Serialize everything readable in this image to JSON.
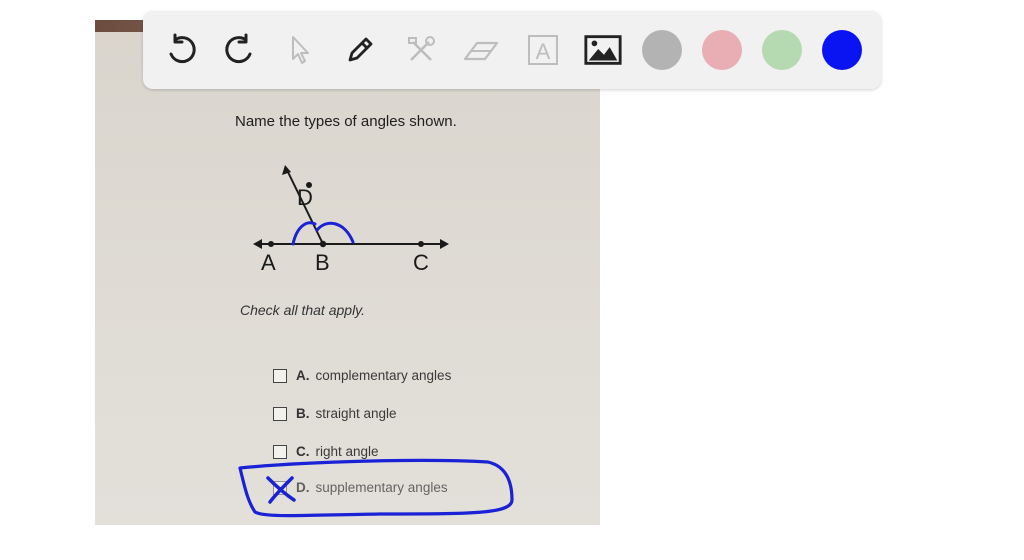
{
  "toolbar": {
    "tools": [
      {
        "name": "undo-icon"
      },
      {
        "name": "redo-icon"
      },
      {
        "name": "select-arrow-icon"
      },
      {
        "name": "pen-icon"
      },
      {
        "name": "tools-icon"
      },
      {
        "name": "eraser-icon"
      },
      {
        "name": "text-box-icon",
        "glyph": "A"
      },
      {
        "name": "image-icon"
      }
    ],
    "colors": [
      "#b3b3b3",
      "#e8aeb4",
      "#b5d9b0",
      "#0a14f2"
    ]
  },
  "question": {
    "prompt": "Name the types of angles shown.",
    "points": {
      "a": "A",
      "b": "B",
      "c": "C",
      "d": "D"
    },
    "instruction": "Check all that apply.",
    "options": [
      {
        "letter": "A.",
        "text": "complementary angles"
      },
      {
        "letter": "B.",
        "text": "straight angle"
      },
      {
        "letter": "C.",
        "text": "right angle"
      },
      {
        "letter": "D.",
        "text": "supplementary angles"
      }
    ]
  },
  "annotation_color": "#1a22d6"
}
